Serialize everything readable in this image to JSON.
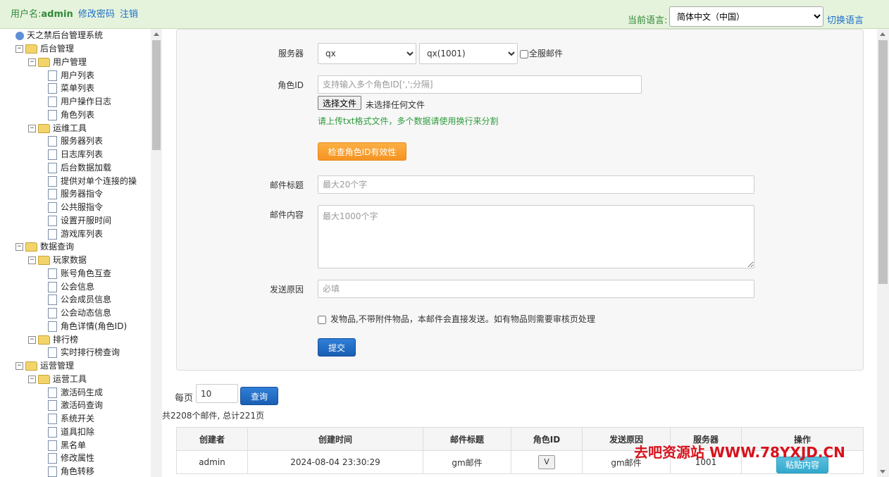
{
  "header": {
    "user_label": "用户名:",
    "username": "admin",
    "change_password": "修改密码",
    "logout": "注销",
    "lang_label": "当前语言:",
    "lang_selected": "简体中文（中国）",
    "switch_lang": "切换语言"
  },
  "tree": {
    "root": "天之禁后台管理系统",
    "items": [
      {
        "label": "后台管理",
        "kind": "folder",
        "level": 1
      },
      {
        "label": "用户管理",
        "kind": "folder",
        "level": 2
      },
      {
        "label": "用户列表",
        "kind": "doc",
        "level": 3
      },
      {
        "label": "菜单列表",
        "kind": "doc",
        "level": 3
      },
      {
        "label": "用户操作日志",
        "kind": "doc",
        "level": 3
      },
      {
        "label": "角色列表",
        "kind": "doc",
        "level": 3
      },
      {
        "label": "运维工具",
        "kind": "folder",
        "level": 2
      },
      {
        "label": "服务器列表",
        "kind": "doc",
        "level": 3
      },
      {
        "label": "日志库列表",
        "kind": "doc",
        "level": 3
      },
      {
        "label": "后台数据加载",
        "kind": "doc",
        "level": 3
      },
      {
        "label": "提供对单个连接的操",
        "kind": "doc",
        "level": 3
      },
      {
        "label": "服务器指令",
        "kind": "doc",
        "level": 3
      },
      {
        "label": "公共服指令",
        "kind": "doc",
        "level": 3
      },
      {
        "label": "设置开服时间",
        "kind": "doc",
        "level": 3
      },
      {
        "label": "游戏库列表",
        "kind": "doc",
        "level": 3
      },
      {
        "label": "数据查询",
        "kind": "folder",
        "level": 1
      },
      {
        "label": "玩家数据",
        "kind": "folder",
        "level": 2
      },
      {
        "label": "账号角色互查",
        "kind": "doc",
        "level": 3
      },
      {
        "label": "公会信息",
        "kind": "doc",
        "level": 3
      },
      {
        "label": "公会成员信息",
        "kind": "doc",
        "level": 3
      },
      {
        "label": "公会动态信息",
        "kind": "doc",
        "level": 3
      },
      {
        "label": "角色详情(角色ID)",
        "kind": "doc",
        "level": 3
      },
      {
        "label": "排行榜",
        "kind": "folder",
        "level": 2
      },
      {
        "label": "实时排行榜查询",
        "kind": "doc",
        "level": 3
      },
      {
        "label": "运营管理",
        "kind": "folder",
        "level": 1
      },
      {
        "label": "运营工具",
        "kind": "folder",
        "level": 2
      },
      {
        "label": "激活码生成",
        "kind": "doc",
        "level": 3
      },
      {
        "label": "激活码查询",
        "kind": "doc",
        "level": 3
      },
      {
        "label": "系统开关",
        "kind": "doc",
        "level": 3
      },
      {
        "label": "道具扣除",
        "kind": "doc",
        "level": 3
      },
      {
        "label": "黑名单",
        "kind": "doc",
        "level": 3
      },
      {
        "label": "修改属性",
        "kind": "doc",
        "level": 3
      },
      {
        "label": "角色转移",
        "kind": "doc",
        "level": 3
      }
    ]
  },
  "form": {
    "server_label": "服务器",
    "server_group": "qx",
    "server": "qx(1001)",
    "all_servers": "全服邮件",
    "role_label": "角色ID",
    "role_placeholder": "支持输入多个角色ID[',';分隔]",
    "choose_file": "选择文件",
    "no_file": "未选择任何文件",
    "upload_hint": "请上传txt格式文件，多个数据请使用换行来分割",
    "check_button": "检查角色ID有效性",
    "title_label": "邮件标题",
    "title_placeholder": "最大20个字",
    "content_label": "邮件内容",
    "content_placeholder": "最大1000个字",
    "reason_label": "发送原因",
    "reason_placeholder": "必填",
    "direct_send": "发物品,不带附件物品，本邮件会直接发送。如有物品则需要审核页处理",
    "submit": "提交"
  },
  "pager": {
    "per_page_label": "每页",
    "per_page": "10",
    "query": "查询",
    "summary": "共2208个邮件, 总计221页"
  },
  "table": {
    "columns": [
      "创建者",
      "创建时间",
      "邮件标题",
      "角色ID",
      "发送原因",
      "服务器",
      "操作"
    ],
    "rows": [
      {
        "creator": "admin",
        "time": "2024-08-04 23:30:29",
        "title": "gm邮件",
        "role": "V",
        "reason": "gm邮件",
        "server": "1001",
        "action": "粘贴内容"
      }
    ]
  },
  "watermark": "去吧资源站 WWW.78YXJD.CN"
}
